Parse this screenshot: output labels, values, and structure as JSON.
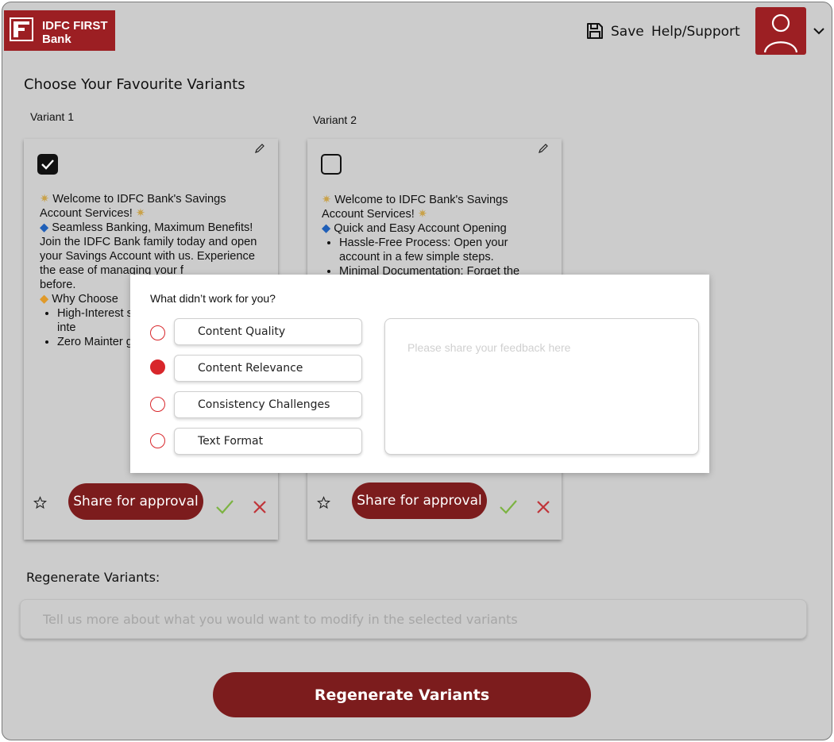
{
  "header": {
    "brand_line1": "IDFC FIRST",
    "brand_line2": "Bank",
    "save_label": "Save",
    "help_label": "Help/Support"
  },
  "page_title": "Choose Your Favourite Variants",
  "variants": [
    {
      "label": "Variant 1",
      "selected": true,
      "lines": [
        "Welcome to IDFC Bank's Savings Account Services!",
        "Seamless Banking, Maximum Benefits! Join the IDFC Bank family today and open your Savings Account with us. Experience the ease of managing your f",
        "before.",
        "Why Choose"
      ],
      "bullets": [
        "High-Interest savings grow attractive inte",
        "Zero Mainter goodbye to a charges."
      ],
      "share_label": "Share for approval"
    },
    {
      "label": "Variant 2",
      "selected": false,
      "lines": [
        "Welcome to IDFC Bank's Savings Account Services!",
        "Quick and Easy Account Opening"
      ],
      "bullets": [
        "Hassle-Free Process: Open your account in a few simple steps.",
        "Minimal Documentation: Forget the"
      ],
      "share_label": "Share for approval"
    }
  ],
  "feedback": {
    "title": "What didn’t work for you?",
    "options": [
      {
        "label": "Content Quality",
        "selected": false
      },
      {
        "label": "Content Relevance",
        "selected": true
      },
      {
        "label": "Consistency Challenges",
        "selected": false
      },
      {
        "label": "Text Format",
        "selected": false
      }
    ],
    "placeholder": "Please share your feedback here"
  },
  "regenerate": {
    "label": "Regenerate Variants:",
    "placeholder": "Tell us more about what you would want to modify in the selected variants",
    "button_label": "Regenerate Variants"
  },
  "colors": {
    "brand": "#9c1f23",
    "button": "#7c1c1d",
    "radio": "#d8262b",
    "approve": "#7cb342",
    "reject": "#c0353a",
    "diamond_blue": "#1f5fb8",
    "diamond_orange": "#e09a2a",
    "sparkle": "#c9a24a"
  }
}
